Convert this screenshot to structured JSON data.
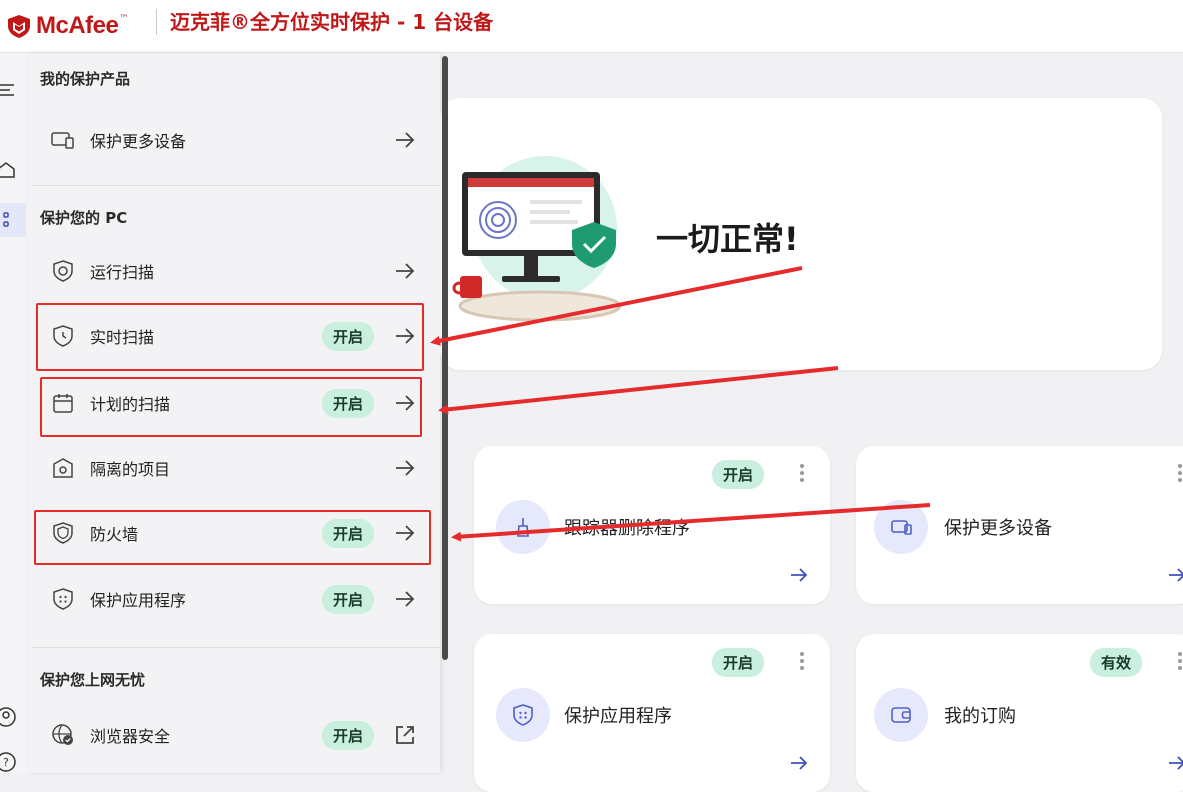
{
  "header": {
    "brand": "McAfee",
    "title": "迈克菲®全方位实时保护 - 1 台设备"
  },
  "menu": {
    "section_products": "我的保护产品",
    "protect_more_devices": "保护更多设备",
    "section_pc": "保护您的 PC",
    "run_scan": "运行扫描",
    "realtime_scan": "实时扫描",
    "realtime_scan_status": "开启",
    "scheduled_scan": "计划的扫描",
    "scheduled_scan_status": "开启",
    "quarantine": "隔离的项目",
    "firewall": "防火墙",
    "firewall_status": "开启",
    "app_protect": "保护应用程序",
    "app_protect_status": "开启",
    "section_web": "保护您上网无忧",
    "browser_security": "浏览器安全",
    "browser_security_status": "开启"
  },
  "main": {
    "status_text": "一切正常!",
    "tiles": [
      {
        "label": "跟踪器删除程序",
        "badge": "开启"
      },
      {
        "label": "保护更多设备",
        "badge": ""
      },
      {
        "label": "保护应用程序",
        "badge": "开启"
      },
      {
        "label": "我的订购",
        "badge": "有效"
      }
    ]
  },
  "colors": {
    "brand_red": "#c01818",
    "badge_green": "#c9efdf",
    "annotation_red": "#e52b2b",
    "icon_bg": "#e6e9fb",
    "icon_blue": "#5060c8"
  }
}
